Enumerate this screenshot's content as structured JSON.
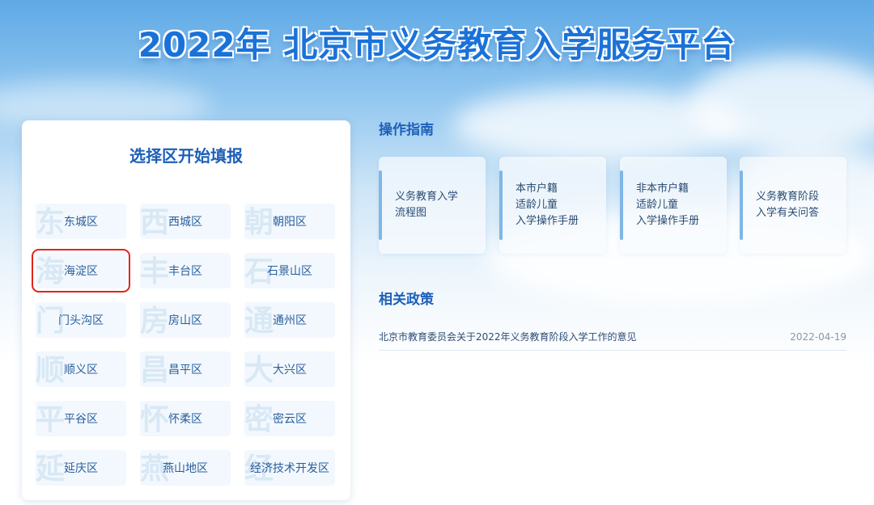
{
  "header": {
    "title": "2022年 北京市义务教育入学服务平台"
  },
  "district_panel": {
    "title": "选择区开始填报",
    "selected": "海淀区",
    "districts": [
      {
        "label": "东城区",
        "watermark": "东"
      },
      {
        "label": "西城区",
        "watermark": "西"
      },
      {
        "label": "朝阳区",
        "watermark": "朝"
      },
      {
        "label": "海淀区",
        "watermark": "海"
      },
      {
        "label": "丰台区",
        "watermark": "丰"
      },
      {
        "label": "石景山区",
        "watermark": "石"
      },
      {
        "label": "门头沟区",
        "watermark": "门"
      },
      {
        "label": "房山区",
        "watermark": "房"
      },
      {
        "label": "通州区",
        "watermark": "通"
      },
      {
        "label": "顺义区",
        "watermark": "顺"
      },
      {
        "label": "昌平区",
        "watermark": "昌"
      },
      {
        "label": "大兴区",
        "watermark": "大"
      },
      {
        "label": "平谷区",
        "watermark": "平"
      },
      {
        "label": "怀柔区",
        "watermark": "怀"
      },
      {
        "label": "密云区",
        "watermark": "密"
      },
      {
        "label": "延庆区",
        "watermark": "延"
      },
      {
        "label": "燕山地区",
        "watermark": "燕"
      },
      {
        "label": "经济技术开发区",
        "watermark": "经"
      }
    ]
  },
  "guide": {
    "title": "操作指南",
    "cards": [
      {
        "lines": [
          "义务教育入学",
          "流程图"
        ]
      },
      {
        "lines": [
          "本市户籍",
          "适龄儿童",
          "入学操作手册"
        ]
      },
      {
        "lines": [
          "非本市户籍",
          "适龄儿童",
          "入学操作手册"
        ]
      },
      {
        "lines": [
          "义务教育阶段",
          "入学有关问答"
        ]
      }
    ]
  },
  "policy": {
    "title": "相关政策",
    "items": [
      {
        "text": "北京市教育委员会关于2022年义务教育阶段入学工作的意见",
        "date": "2022-04-19"
      }
    ]
  },
  "colors": {
    "accent": "#1a72d9",
    "selected_outline": "#e0241b",
    "district_bg": "#f2f8fd"
  }
}
